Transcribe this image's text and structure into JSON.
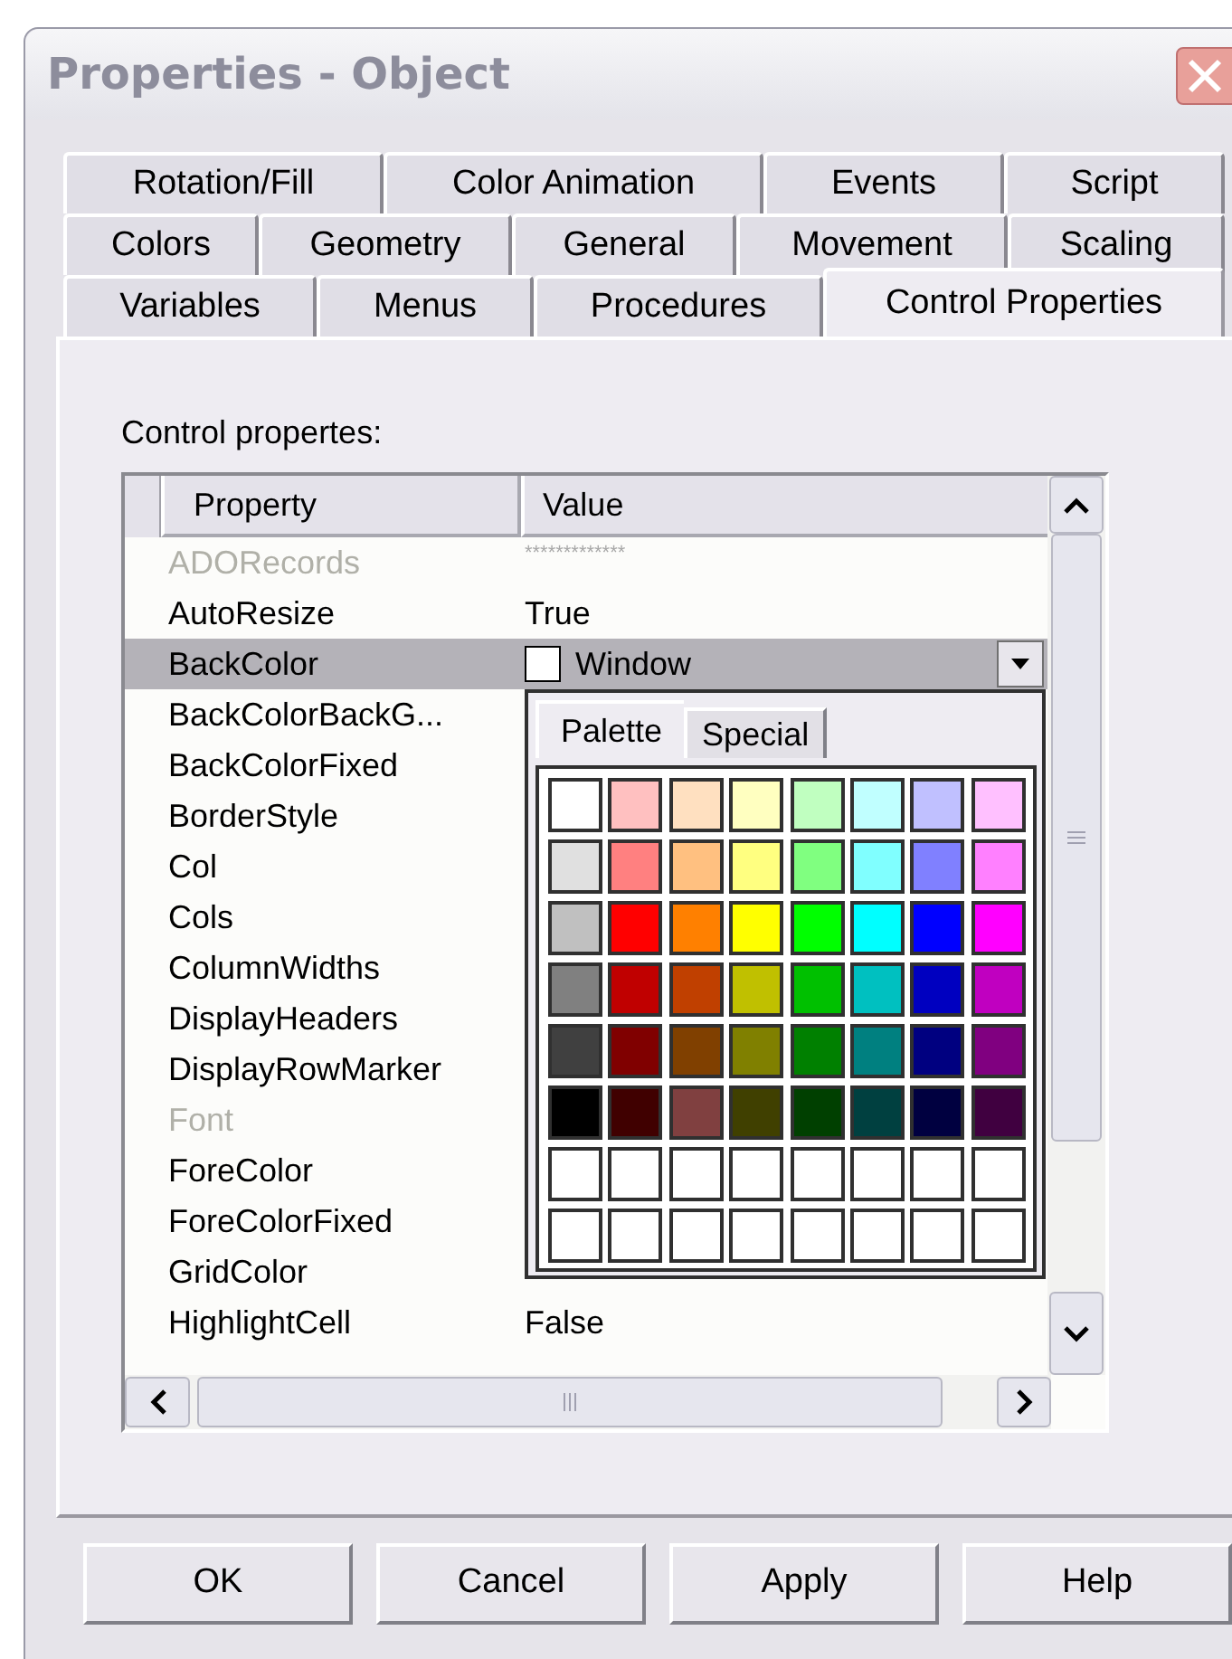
{
  "window": {
    "title": "Properties - Object"
  },
  "tab_rows": [
    [
      {
        "label": "Rotation/Fill",
        "selected": false
      },
      {
        "label": "Color Animation",
        "selected": false
      },
      {
        "label": "Events",
        "selected": false
      },
      {
        "label": "Script",
        "selected": false
      }
    ],
    [
      {
        "label": "Colors",
        "selected": false
      },
      {
        "label": "Geometry",
        "selected": false
      },
      {
        "label": "General",
        "selected": false
      },
      {
        "label": "Movement",
        "selected": false
      },
      {
        "label": "Scaling",
        "selected": false
      }
    ],
    [
      {
        "label": "Variables",
        "selected": false
      },
      {
        "label": "Menus",
        "selected": false
      },
      {
        "label": "Procedures",
        "selected": false
      },
      {
        "label": "Control Properties",
        "selected": true
      }
    ]
  ],
  "section_label": "Control propertes:",
  "table": {
    "columns": [
      "Property",
      "Value"
    ],
    "rows": [
      {
        "property": "ADORecords",
        "value": "*************",
        "kind": "masked",
        "disabled": true,
        "selected": false
      },
      {
        "property": "AutoResize",
        "value": "True",
        "kind": "text",
        "disabled": false,
        "selected": false
      },
      {
        "property": "BackColor",
        "value": "Window",
        "kind": "color",
        "color": "#ffffff",
        "disabled": false,
        "selected": true
      },
      {
        "property": "BackColorBackG...",
        "kind": "text",
        "disabled": false,
        "selected": false
      },
      {
        "property": "BackColorFixed",
        "kind": "text",
        "disabled": false,
        "selected": false
      },
      {
        "property": "BorderStyle",
        "kind": "text",
        "disabled": false,
        "selected": false
      },
      {
        "property": "Col",
        "kind": "text",
        "disabled": false,
        "selected": false
      },
      {
        "property": "Cols",
        "kind": "text",
        "disabled": false,
        "selected": false
      },
      {
        "property": "ColumnWidths",
        "kind": "text",
        "disabled": false,
        "selected": false
      },
      {
        "property": "DisplayHeaders",
        "kind": "text",
        "disabled": false,
        "selected": false
      },
      {
        "property": "DisplayRowMarker",
        "kind": "text",
        "disabled": false,
        "selected": false
      },
      {
        "property": "Font",
        "kind": "text",
        "disabled": true,
        "selected": false
      },
      {
        "property": "ForeColor",
        "kind": "text",
        "disabled": false,
        "selected": false
      },
      {
        "property": "ForeColorFixed",
        "kind": "text",
        "disabled": false,
        "selected": false
      },
      {
        "property": "GridColor",
        "kind": "text",
        "disabled": false,
        "selected": false
      },
      {
        "property": "HighlightCell",
        "value": "False",
        "kind": "text",
        "disabled": false,
        "selected": false
      }
    ]
  },
  "color_popup": {
    "tabs": [
      {
        "label": "Palette",
        "selected": true
      },
      {
        "label": "Special",
        "selected": false
      }
    ],
    "swatches": [
      {
        "color": "#ffffff"
      },
      {
        "color": "#ffc0c0"
      },
      {
        "color": "#ffe0c0"
      },
      {
        "color": "#ffffc0"
      },
      {
        "color": "#c0ffc0"
      },
      {
        "color": "#c0ffff"
      },
      {
        "color": "#c0c0ff"
      },
      {
        "color": "#ffc0ff"
      },
      {
        "color": "#e0e0e0"
      },
      {
        "color": "#ff8080"
      },
      {
        "color": "#ffc080"
      },
      {
        "color": "#ffff80"
      },
      {
        "color": "#80ff80"
      },
      {
        "color": "#80ffff"
      },
      {
        "color": "#8080ff"
      },
      {
        "color": "#ff80ff"
      },
      {
        "color": "#c0c0c0"
      },
      {
        "color": "#ff0000"
      },
      {
        "color": "#ff8000"
      },
      {
        "color": "#ffff00"
      },
      {
        "color": "#00ff00"
      },
      {
        "color": "#00ffff"
      },
      {
        "color": "#0000ff"
      },
      {
        "color": "#ff00ff"
      },
      {
        "color": "#808080"
      },
      {
        "color": "#c00000"
      },
      {
        "color": "#c04000"
      },
      {
        "color": "#c0c000"
      },
      {
        "color": "#00c000"
      },
      {
        "color": "#00c0c0"
      },
      {
        "color": "#0000c0"
      },
      {
        "color": "#c000c0"
      },
      {
        "color": "#404040"
      },
      {
        "color": "#800000"
      },
      {
        "color": "#804000"
      },
      {
        "color": "#808000"
      },
      {
        "color": "#008000"
      },
      {
        "color": "#008080"
      },
      {
        "color": "#000080"
      },
      {
        "color": "#800080"
      },
      {
        "color": "#000000"
      },
      {
        "color": "#400000"
      },
      {
        "color": "#804040"
      },
      {
        "color": "#404000"
      },
      {
        "color": "#004000"
      },
      {
        "color": "#004040"
      },
      {
        "color": "#000040"
      },
      {
        "color": "#400040"
      },
      {
        "color": "#ffffff"
      },
      {
        "color": "#ffffff"
      },
      {
        "color": "#ffffff"
      },
      {
        "color": "#ffffff"
      },
      {
        "color": "#ffffff"
      },
      {
        "color": "#ffffff"
      },
      {
        "color": "#ffffff"
      },
      {
        "color": "#ffffff"
      },
      {
        "color": "#ffffff"
      },
      {
        "color": "#ffffff"
      },
      {
        "color": "#ffffff"
      },
      {
        "color": "#ffffff"
      },
      {
        "color": "#ffffff"
      },
      {
        "color": "#ffffff"
      },
      {
        "color": "#ffffff"
      },
      {
        "color": "#ffffff"
      }
    ]
  },
  "buttons": [
    {
      "label": "OK"
    },
    {
      "label": "Cancel"
    },
    {
      "label": "Apply"
    },
    {
      "label": "Help"
    }
  ]
}
